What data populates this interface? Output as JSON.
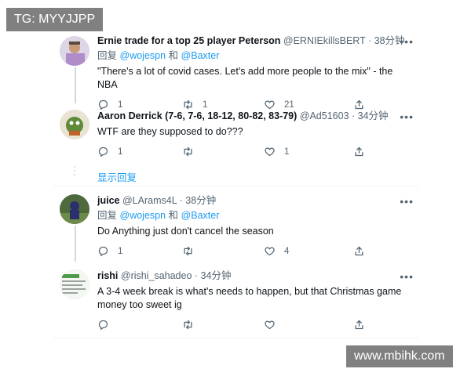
{
  "watermarks": {
    "top_left": "TG: MYYJJPP",
    "bottom_right": "www.mbihk.com"
  },
  "tweets": [
    {
      "name": "Ernie trade for a top 25 player Peterson",
      "handle": "@ERNIEkillsBERT",
      "time": "· 38分钟",
      "reply_prefix": "回复",
      "mention1": "@wojespn",
      "reply_and": "和",
      "mention2": "@Baxter",
      "text": "\"There's a lot of covid cases. Let's add more people to the mix\" - the NBA",
      "reply_count": "1",
      "retweet_count": "1",
      "like_count": "21",
      "more": "•••"
    },
    {
      "name": "Aaron Derrick (7-6, 7-6, 18-12, 80-82, 83-79)",
      "handle": "@Ad51603",
      "time": "· 34分钟",
      "text": "WTF are they supposed to do???",
      "reply_count": "1",
      "retweet_count": "",
      "like_count": "1",
      "more": "•••"
    },
    {
      "name": "juice",
      "handle": "@LArams4L",
      "time": "· 38分钟",
      "reply_prefix": "回复",
      "mention1": "@wojespn",
      "reply_and": "和",
      "mention2": "@Baxter",
      "text": "Do Anything just don't cancel the season",
      "reply_count": "1",
      "retweet_count": "",
      "like_count": "4",
      "more": "•••"
    },
    {
      "name": "rishi",
      "handle": "@rishi_sahadeo",
      "time": "· 34分钟",
      "text": "A 3-4 week break is what's needs to happen, but that Christmas game money too sweet ig",
      "reply_count": "",
      "retweet_count": "",
      "like_count": "",
      "more": "•••"
    }
  ],
  "show_replies": "显示回复",
  "icons": {
    "reply": "reply-icon",
    "retweet": "retweet-icon",
    "like": "heart-icon",
    "share": "share-icon"
  },
  "colors": {
    "accent": "#1d9bf0",
    "muted": "#536471",
    "text": "#0f1419",
    "divider": "#eff3f4"
  }
}
